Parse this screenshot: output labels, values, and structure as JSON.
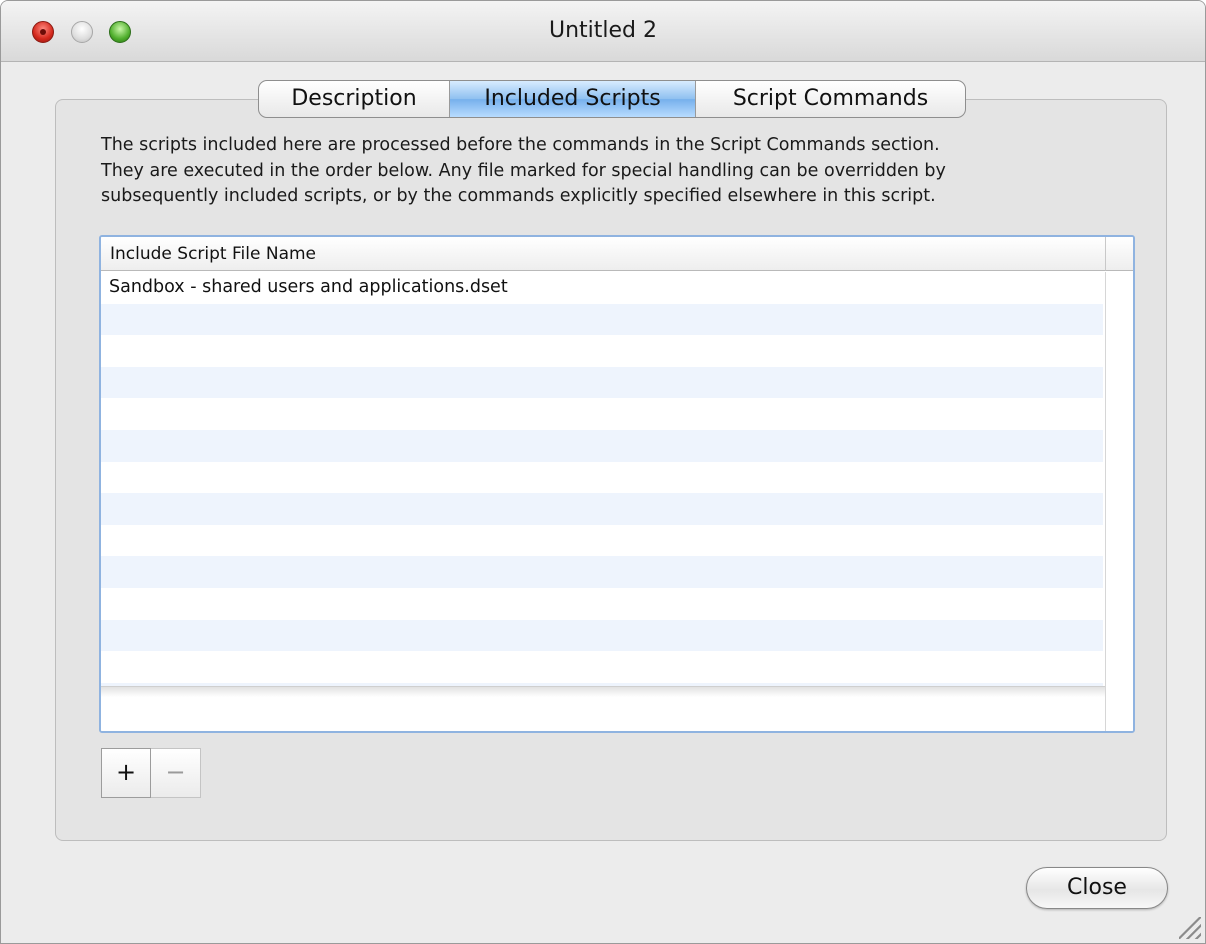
{
  "window": {
    "title": "Untitled 2"
  },
  "tabs": [
    {
      "label": "Description",
      "selected": false
    },
    {
      "label": "Included Scripts",
      "selected": true
    },
    {
      "label": "Script Commands",
      "selected": false
    }
  ],
  "description": {
    "lines": [
      "The scripts included here are processed before the commands in the Script Commands section.",
      "They are executed in the order below. Any file marked for special handling can be overridden by",
      "subsequently included scripts, or by the commands explicitly specified elsewhere in this script."
    ]
  },
  "table": {
    "column_header": "Include Script File Name",
    "rows": [
      "Sandbox - shared users and applications.dset"
    ]
  },
  "controls": {
    "add_label": "+",
    "remove_label": "−",
    "close_label": "Close"
  },
  "colors": {
    "selected_tab": "#8fc0f0",
    "alt_row": "#eef4fd",
    "focus_ring": "#8fb3e0"
  }
}
